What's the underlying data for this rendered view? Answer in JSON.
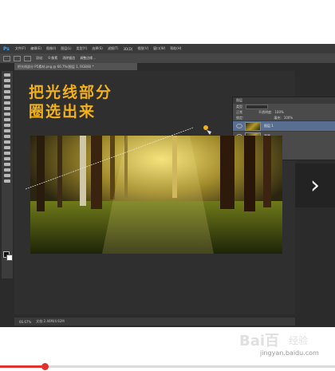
{
  "app": {
    "logo": "Ps",
    "menu": [
      "文件(F)",
      "编辑(E)",
      "图像(I)",
      "图层(L)",
      "类型(Y)",
      "选择(S)",
      "滤镜(T)",
      "3D(D)",
      "视图(V)",
      "窗口(W)",
      "帮助(H)"
    ],
    "options": {
      "feather_label": "羽化:",
      "feather_value": "0 像素",
      "antialias": "消除锯齿",
      "refine": "调整边缘..."
    },
    "doc_tab": "把光线部分 P5素材.png @ 66.7%(图层 1, RGB/8) *"
  },
  "caption": {
    "line1": "把光线部分",
    "line2": "圈选出来"
  },
  "layers": {
    "tab_label": "图层",
    "kind_label": "类型",
    "blend_mode": "正常",
    "opacity_label": "不透明度:",
    "opacity_value": "100%",
    "lock_label": "锁定:",
    "fill_label": "填充:",
    "fill_value": "100%",
    "items": [
      {
        "name": "图层 1",
        "active": true
      },
      {
        "name": "背景",
        "active": false
      }
    ]
  },
  "status": {
    "zoom": "66.67%",
    "doc": "文档:2.46M/4.92M"
  },
  "watermark": {
    "logo": "Bai百",
    "cn": "经验",
    "url": "jingyan.baidu.com"
  },
  "player": {
    "progress": 0.13
  },
  "colors": {
    "caption": "#f2b01b",
    "progress": "#e03030",
    "ps_blue": "#31a8ff"
  }
}
